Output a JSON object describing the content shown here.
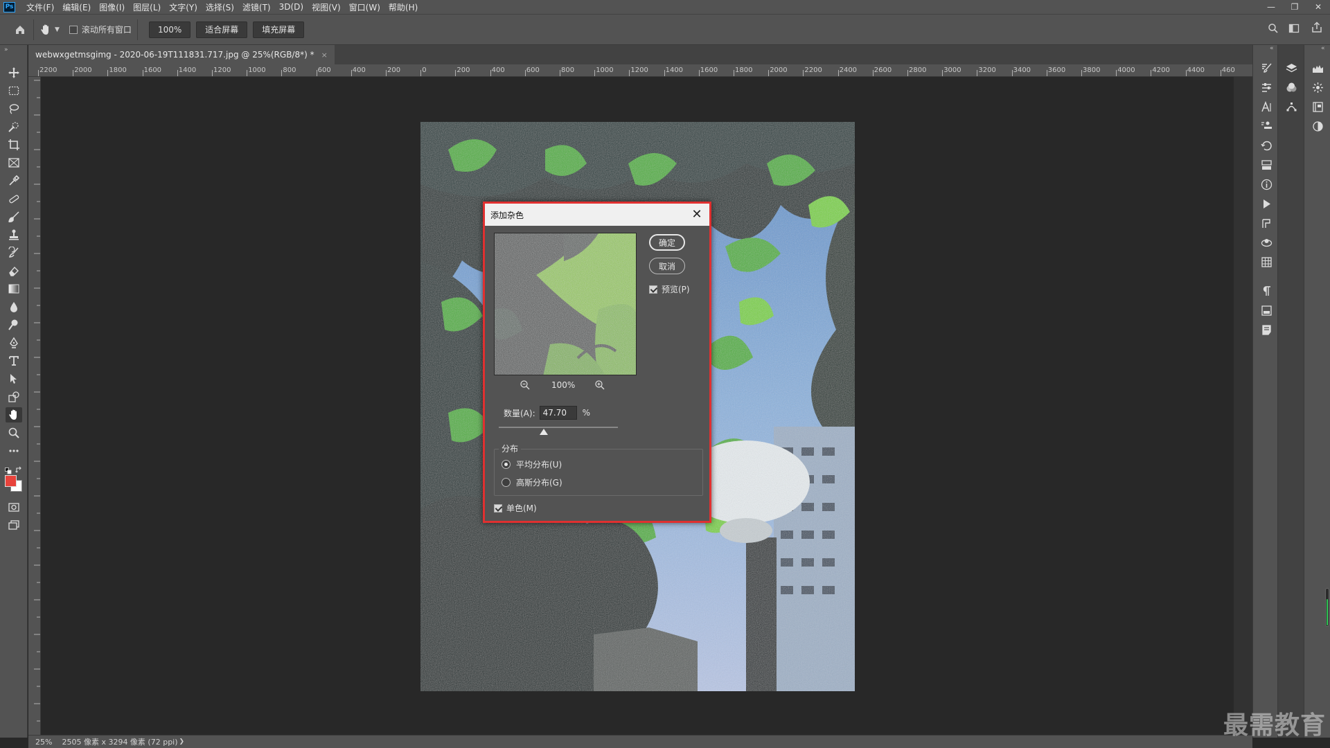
{
  "app": {
    "logo_text": "Ps",
    "menu": [
      "文件(F)",
      "编辑(E)",
      "图像(I)",
      "图层(L)",
      "文字(Y)",
      "选择(S)",
      "滤镜(T)",
      "3D(D)",
      "视图(V)",
      "窗口(W)",
      "帮助(H)"
    ]
  },
  "options_bar": {
    "scroll_all_label": "滚动所有窗口",
    "zoom_button": "100%",
    "fit_screen": "适合屏幕",
    "fill_screen": "填充屏幕"
  },
  "document": {
    "tab_title": "webwxgetmsgimg - 2020-06-19T111831.717.jpg @ 25%(RGB/8*) *",
    "tab_close": "×"
  },
  "ruler": {
    "h_labels": [
      "2200",
      "2000",
      "1800",
      "1600",
      "1400",
      "1200",
      "1000",
      "800",
      "600",
      "400",
      "200",
      "0",
      "200",
      "400",
      "600",
      "800",
      "1000",
      "1200",
      "1400",
      "1600",
      "1800",
      "2000",
      "2200",
      "2400",
      "2600",
      "2800",
      "3000",
      "3200",
      "3400",
      "3600",
      "3800",
      "4000",
      "4200",
      "4400",
      "460"
    ]
  },
  "dialog": {
    "title": "添加杂色",
    "ok": "确定",
    "cancel": "取消",
    "preview_label": "预览(P)",
    "zoom_level": "100%",
    "amount_label": "数量(A):",
    "amount_value": "47.70",
    "amount_unit": "%",
    "amount_slider_fraction": 0.38,
    "distribution_label": "分布",
    "uniform": "平均分布(U)",
    "gaussian": "高斯分布(G)",
    "mono": "单色(M)"
  },
  "status": {
    "zoom": "25%",
    "info": "2505 像素 x 3294 像素 (72 ppi)"
  },
  "watermark": "最需教育",
  "colors": {
    "foreground": "#e8433c",
    "background": "#ffffff",
    "highlight": "#e03030"
  }
}
